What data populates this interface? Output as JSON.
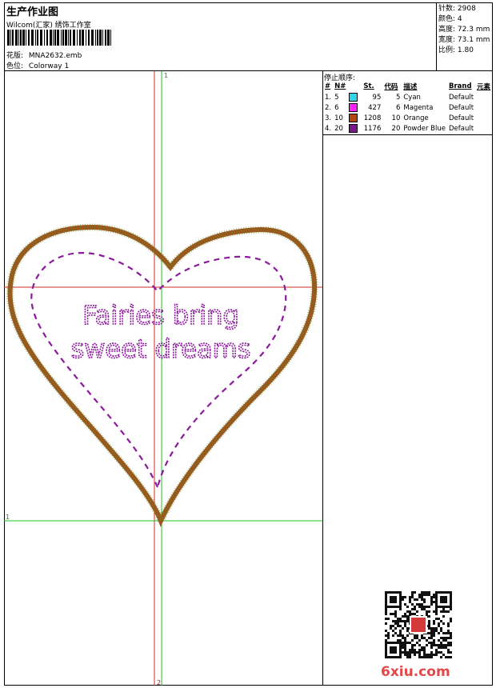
{
  "header": {
    "title": "生产作业图",
    "subtitle": "Wilcom(汇家) 绣饰工作室",
    "design_label": "花版:",
    "design_value": "MNA2632.emb",
    "colorway_label": "色位:",
    "colorway_value": "Colorway 1"
  },
  "stats": {
    "stitches": {
      "label": "针数:",
      "value": "2908"
    },
    "colors": {
      "label": "颜色:",
      "value": "4"
    },
    "height": {
      "label": "高度:",
      "value": "72.3 mm"
    },
    "width": {
      "label": "宽度:",
      "value": "73.1 mm"
    },
    "scale": {
      "label": "比例:",
      "value": "1.80"
    }
  },
  "stop_sequence": {
    "title": "停止顺序:",
    "columns": [
      "#",
      "N#",
      "St.",
      "代码",
      "描述",
      "Brand",
      "元素"
    ],
    "rows": [
      {
        "idx": "1.",
        "n": "5",
        "color": "#33d6e6",
        "st": "95",
        "code": "5",
        "desc": "Cyan",
        "brand": "Default"
      },
      {
        "idx": "2.",
        "n": "6",
        "color": "#ff22ff",
        "st": "427",
        "code": "6",
        "desc": "Magenta",
        "brand": "Default"
      },
      {
        "idx": "3.",
        "n": "10",
        "color": "#b04a10",
        "st": "1208",
        "code": "10",
        "desc": "Orange",
        "brand": "Default"
      },
      {
        "idx": "4.",
        "n": "20",
        "color": "#7a1a8a",
        "st": "1176",
        "code": "20",
        "desc": "Powder Blue",
        "brand": "Default"
      }
    ]
  },
  "design": {
    "text_line1": "Fairies bring",
    "text_line2": "sweet dreams",
    "marker_top": "1",
    "marker_left": "1",
    "marker_bottom": "2",
    "heart_color": "#a0521e",
    "stitch_color": "#8b1a9c",
    "guide_red": "#d42a2a",
    "guide_green": "#22c022"
  },
  "watermark": {
    "text": "6xiu.com"
  }
}
